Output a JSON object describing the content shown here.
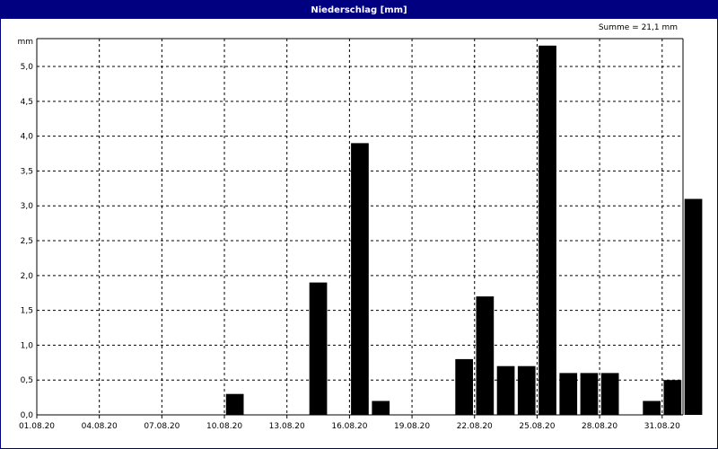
{
  "window": {
    "title": "Niederschlag [mm]"
  },
  "annotation": {
    "sum_label": "Summe = 21,1 mm"
  },
  "chart_data": {
    "type": "bar",
    "title": "Niederschlag [mm]",
    "ylabel": "mm",
    "xlabel": "",
    "ylim": [
      0,
      5.4
    ],
    "y_ticks": [
      "0,0",
      "0,5",
      "1,0",
      "1,5",
      "2,0",
      "2,5",
      "3,0",
      "3,5",
      "4,0",
      "4,5",
      "5,0"
    ],
    "x_tick_labels": [
      "01.08.20",
      "04.08.20",
      "07.08.20",
      "10.08.20",
      "13.08.20",
      "16.08.20",
      "19.08.20",
      "22.08.20",
      "25.08.20",
      "28.08.20",
      "31.08.20"
    ],
    "categories": [
      "01.08.20",
      "02.08.20",
      "03.08.20",
      "04.08.20",
      "05.08.20",
      "06.08.20",
      "07.08.20",
      "08.08.20",
      "09.08.20",
      "10.08.20",
      "11.08.20",
      "12.08.20",
      "13.08.20",
      "14.08.20",
      "15.08.20",
      "16.08.20",
      "17.08.20",
      "18.08.20",
      "19.08.20",
      "20.08.20",
      "21.08.20",
      "22.08.20",
      "23.08.20",
      "24.08.20",
      "25.08.20",
      "26.08.20",
      "27.08.20",
      "28.08.20",
      "29.08.20",
      "30.08.20",
      "31.08.20"
    ],
    "values": [
      0,
      0,
      0,
      0,
      0,
      0,
      0,
      0,
      0,
      0.3,
      0,
      0,
      0,
      1.9,
      0,
      3.9,
      0.2,
      0,
      0,
      0,
      0.8,
      1.7,
      0.7,
      0.7,
      5.3,
      0.6,
      0.6,
      0.6,
      0,
      0.2,
      0.5,
      3.1
    ],
    "grid": true,
    "bar_color": "#000000",
    "grid_color": "#000000"
  }
}
